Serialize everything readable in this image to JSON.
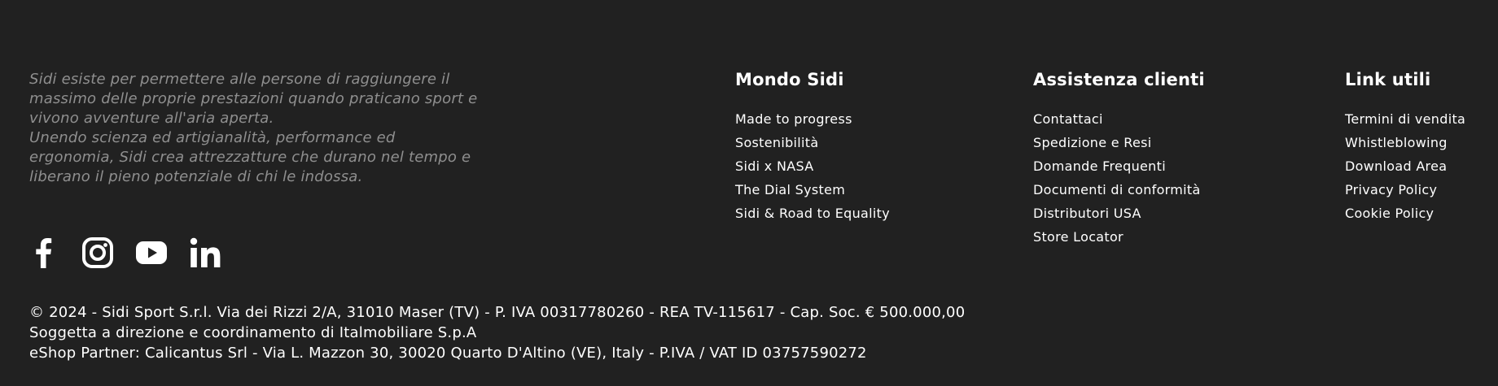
{
  "colors": {
    "background": "#212121",
    "text": "#ffffff",
    "mission_text": "#8f8f8f"
  },
  "mission": {
    "line1": "Sidi esiste per permettere alle persone di raggiungere il massimo delle proprie prestazioni quando praticano sport e vivono avventure all'aria aperta.",
    "line2": "Unendo scienza ed artigianalità, performance ed ergonomia, Sidi crea attrezzatture che durano nel tempo e liberano il pieno potenziale di chi le indossa."
  },
  "social": [
    {
      "name": "facebook",
      "icon": "facebook-icon"
    },
    {
      "name": "instagram",
      "icon": "instagram-icon"
    },
    {
      "name": "youtube",
      "icon": "youtube-icon"
    },
    {
      "name": "linkedin",
      "icon": "linkedin-icon"
    }
  ],
  "columns": {
    "mondo": {
      "title": "Mondo Sidi",
      "items": [
        "Made to progress",
        "Sostenibilità",
        "Sidi x NASA",
        "The Dial System",
        "Sidi & Road to Equality"
      ]
    },
    "assistenza": {
      "title": "Assistenza clienti",
      "items": [
        "Contattaci",
        "Spedizione e Resi",
        "Domande Frequenti",
        "Documenti di conformità",
        "Distributori USA",
        "Store Locator"
      ]
    },
    "link": {
      "title": "Link utili",
      "items": [
        "Termini di vendita",
        "Whistleblowing",
        "Download Area",
        "Privacy Policy",
        "Cookie Policy"
      ]
    }
  },
  "legal": {
    "line1": "© 2024 - Sidi Sport S.r.l. Via dei Rizzi 2/A, 31010 Maser (TV) - P. IVA 00317780260 - REA TV-115617 - Cap. Soc. € 500.000,00",
    "line2": "Soggetta a direzione e coordinamento di Italmobiliare S.p.A",
    "line3": "eShop Partner: Calicantus Srl - Via L. Mazzon 30, 30020 Quarto D'Altino (VE), Italy - P.IVA / VAT ID 03757590272"
  }
}
